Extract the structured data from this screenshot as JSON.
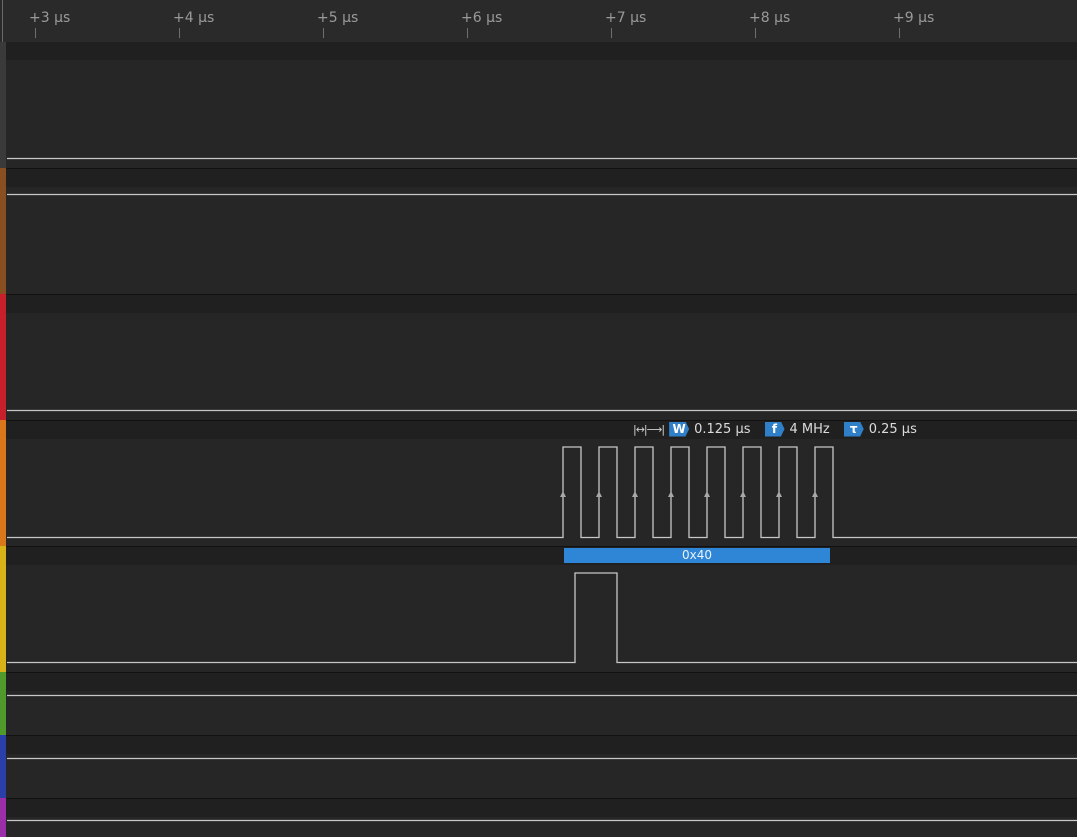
{
  "ruler": {
    "ticks": [
      "+3 µs",
      "+4 µs",
      "+5 µs",
      "+6 µs",
      "+7 µs",
      "+8 µs",
      "+9 µs"
    ]
  },
  "channel_colors": [
    "#3a3a3a",
    "#8a4f20",
    "#c8202a",
    "#d9771c",
    "#d8b217",
    "#4f9a2a",
    "#2a3fa8",
    "#9a2fa8"
  ],
  "measurement": {
    "width_icon": "|↔|⟶|",
    "width_badge": "W",
    "width_value": "0.125 µs",
    "freq_badge": "f",
    "freq_value": "4 MHz",
    "period_badge": "τ",
    "period_value": "0.25 µs"
  },
  "decoder": {
    "value": "0x40"
  },
  "colors": {
    "accent": "#2f86d6",
    "trace": "#c8c8c8",
    "background": "#232323"
  }
}
